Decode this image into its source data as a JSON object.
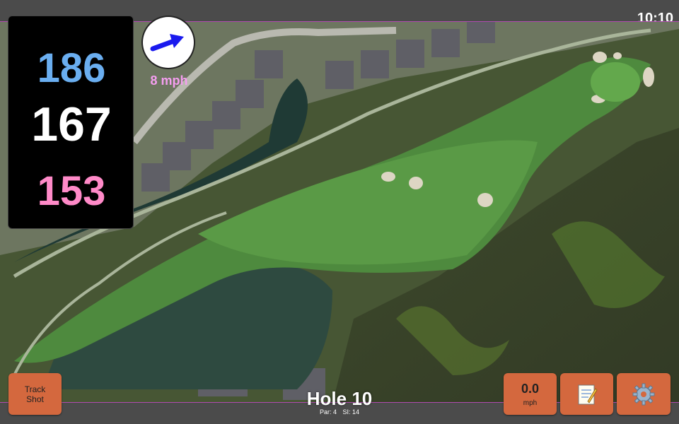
{
  "status": {
    "clock": "10:10"
  },
  "distances": {
    "back": "186",
    "middle": "167",
    "front": "153"
  },
  "wind": {
    "speed": "8 mph",
    "icon": "wind-direction-arrow-icon"
  },
  "buttons": {
    "track_shot": "Track\nShot",
    "speed_value": "0.0",
    "speed_unit": "mph",
    "notes_icon": "notepad-icon",
    "settings_icon": "gear-icon"
  },
  "hole": {
    "title": "Hole 10",
    "par": "Par: 4",
    "si": "SI: 14"
  },
  "colors": {
    "back": "#6aaef0",
    "middle": "#ffffff",
    "front": "#ff8ac8",
    "wind_text": "#f59ef0",
    "button": "#d4683e",
    "map_border": "#b04ab0"
  }
}
